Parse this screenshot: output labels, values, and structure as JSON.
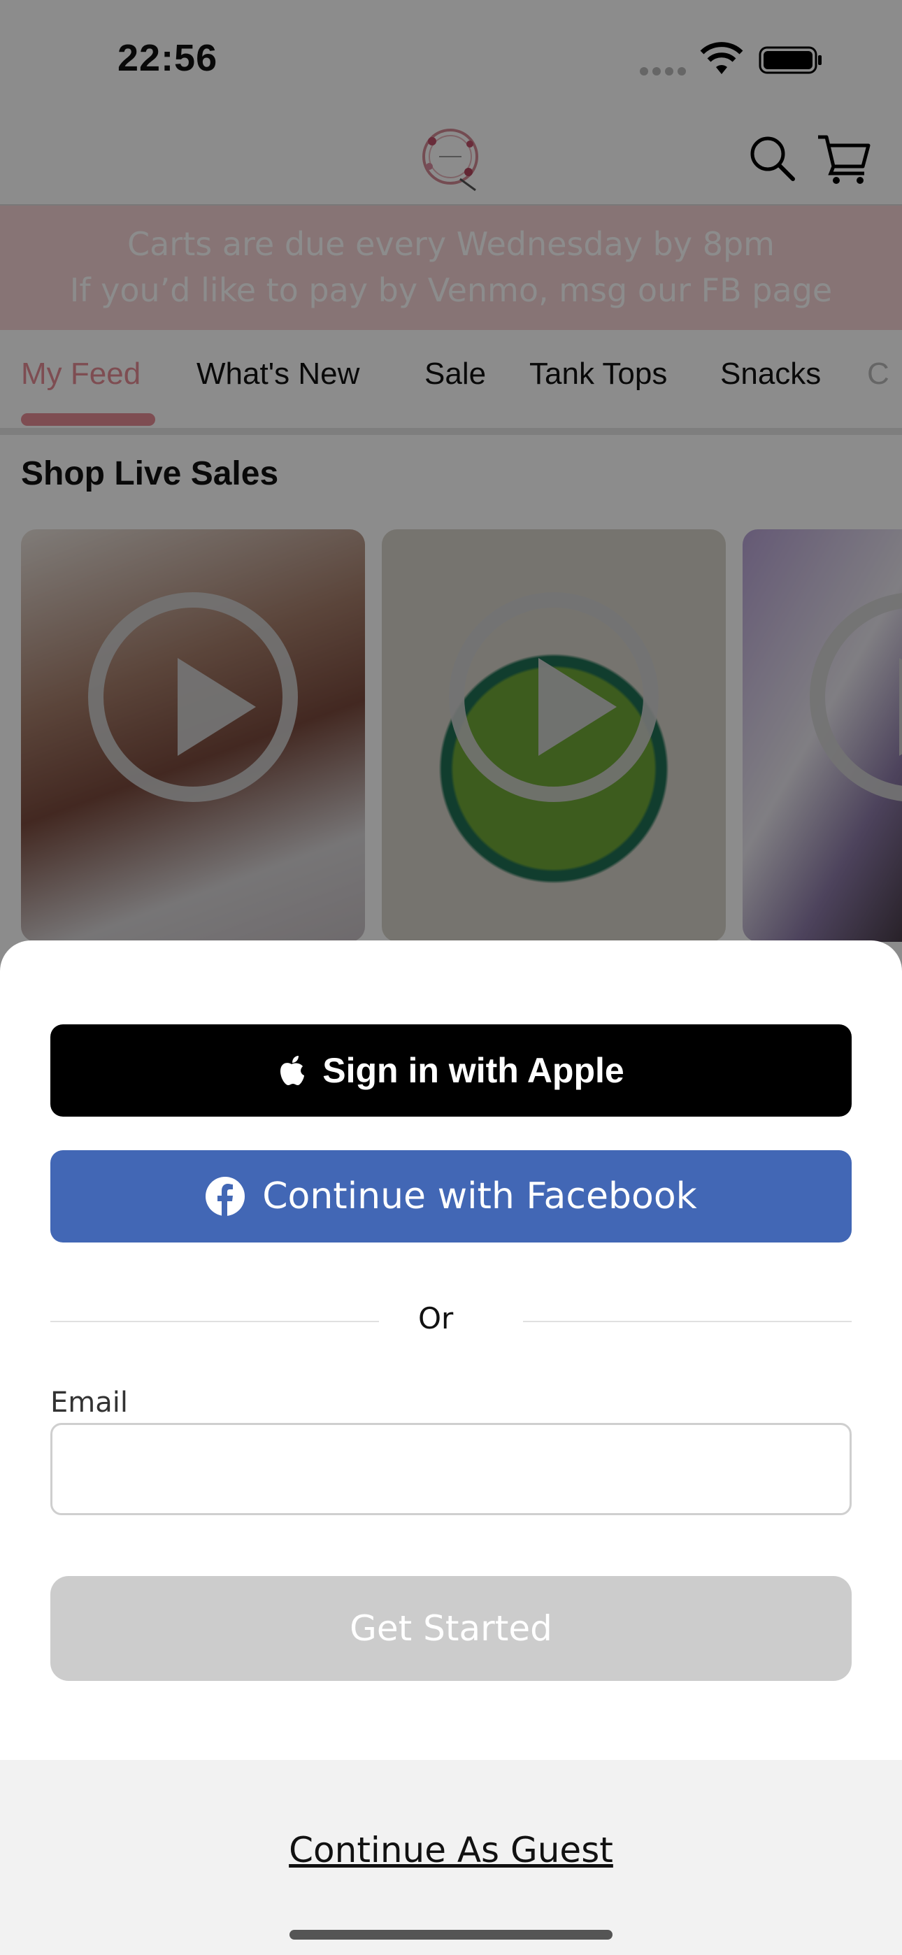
{
  "status_bar": {
    "time": "22:56"
  },
  "header": {
    "logo_icon": "shop-logo",
    "search_icon": "search-icon",
    "cart_icon": "cart-icon"
  },
  "banner": {
    "line1": "Carts are due every Wednesday by 8pm",
    "line2": "If you’d like to pay by Venmo, msg our FB page"
  },
  "tabs": [
    {
      "label": "My Feed",
      "active": true
    },
    {
      "label": "What's New"
    },
    {
      "label": "Sale"
    },
    {
      "label": "Tank Tops"
    },
    {
      "label": "Snacks"
    }
  ],
  "live_sales": {
    "title": "Shop Live Sales",
    "cards": 3
  },
  "sheet": {
    "apple_label": "Sign in with Apple",
    "facebook_label": "Continue with Facebook",
    "or_label": "Or",
    "email_label": "Email",
    "email_value": "",
    "get_started_label": "Get Started",
    "guest_label": "Continue As Guest"
  },
  "colors": {
    "accent": "#e58d95",
    "facebook": "#4267b5",
    "banner": "#f6d3d6"
  }
}
